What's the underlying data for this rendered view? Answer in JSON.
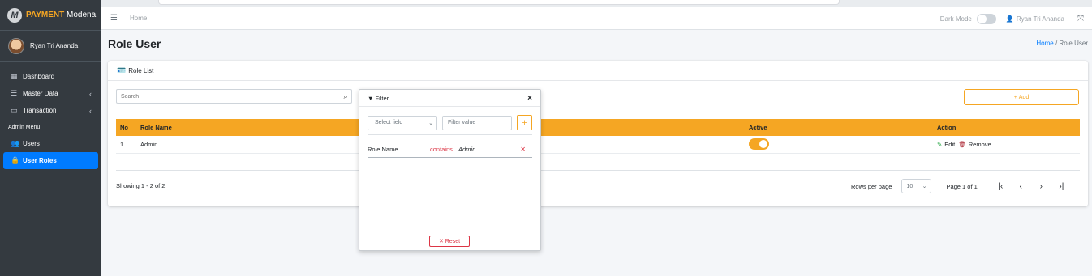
{
  "brand": {
    "logo_letter": "M",
    "accent": "PAYMENT",
    "name": "Modena"
  },
  "user": {
    "name": "Ryan Tri Ananda"
  },
  "sidebar": {
    "items": [
      {
        "label": "Dashboard",
        "icon": "grid-icon"
      },
      {
        "label": "Master Data",
        "icon": "database-icon"
      },
      {
        "label": "Transaction",
        "icon": "credit-card-icon"
      }
    ],
    "header": "Admin Menu",
    "admin_items": [
      {
        "label": "Users",
        "icon": "users-icon"
      },
      {
        "label": "User Roles",
        "icon": "lock-icon"
      }
    ]
  },
  "topbar": {
    "home": "Home",
    "dark_mode": "Dark Mode",
    "user": "Ryan Tri Ananda"
  },
  "page": {
    "title": "Role User",
    "breadcrumb_home": "Home",
    "breadcrumb_sep": "/",
    "breadcrumb_current": "Role User"
  },
  "card": {
    "title": "Role List",
    "search_placeholder": "Search",
    "add_label": "Add",
    "columns": {
      "no": "No",
      "role_name": "Role Name",
      "active": "Active",
      "action": "Action"
    },
    "rows": [
      {
        "no": "1",
        "role_name": "Admin",
        "active": true
      }
    ],
    "edit_label": "Edit",
    "remove_label": "Remove",
    "showing": "Showing 1 - 2 of 2",
    "rows_per_page_label": "Rows per page",
    "rows_per_page": "10",
    "page_info": "Page 1 of 1"
  },
  "filter": {
    "title": "Filter",
    "field_placeholder": "Select field",
    "value_placeholder": "Filter value",
    "rule": {
      "field": "Role Name",
      "operator": "contains",
      "value": "Admin"
    },
    "reset_label": "Reset"
  },
  "colors": {
    "accent": "#f5a623",
    "primary": "#007bff",
    "danger": "#dc3545",
    "sidebar": "#343a40"
  }
}
